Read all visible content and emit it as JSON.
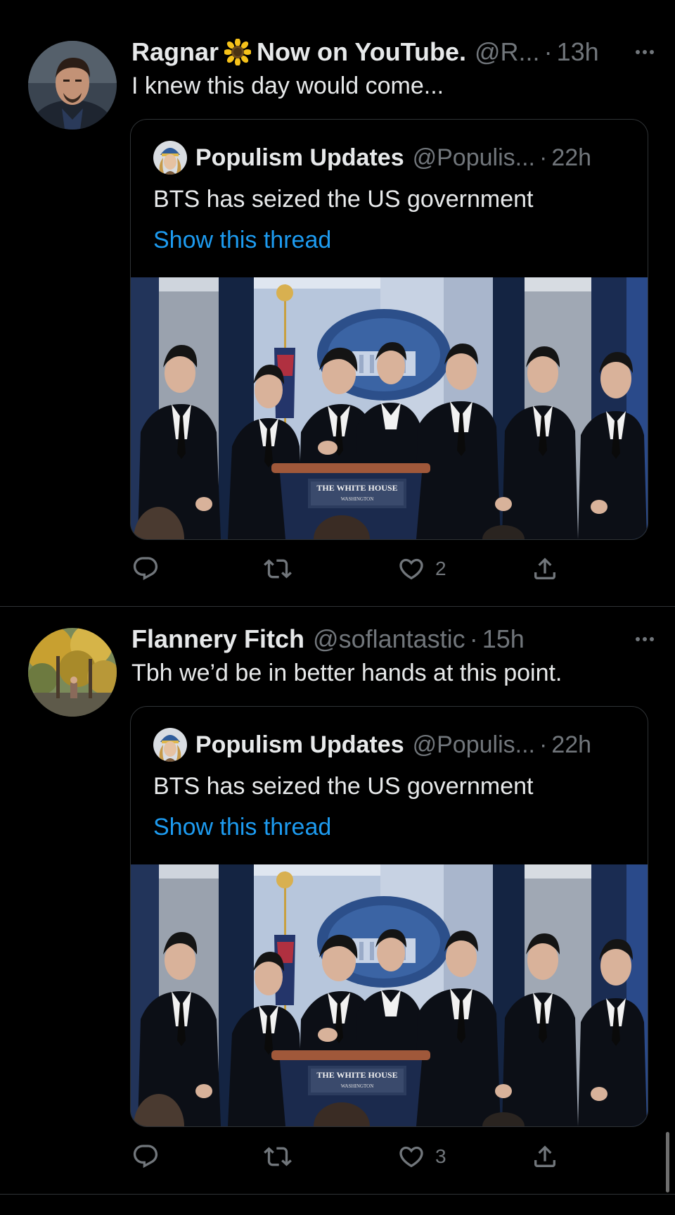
{
  "tweets": [
    {
      "author_name": "Ragnar",
      "author_name_suffix": "Now on YouTube.",
      "handle": "@R...",
      "time": "13h",
      "text": "I knew this day would come...",
      "quote": {
        "author_name": "Populism Updates",
        "handle": "@Populis...",
        "time": "22h",
        "text": "BTS has seized the US government",
        "link": "Show this thread",
        "media_signage": "THE WHITE HOUSE",
        "media_signage_sub": "WASHINGTON"
      },
      "actions": {
        "reply": "",
        "retweet": "",
        "like": "2",
        "share": ""
      }
    },
    {
      "author_name": "Flannery Fitch",
      "handle": "@soflantastic",
      "time": "15h",
      "text": "Tbh we’d be in better hands at this point.",
      "quote": {
        "author_name": "Populism Updates",
        "handle": "@Populis...",
        "time": "22h",
        "text": "BTS has seized the US government",
        "link": "Show this thread",
        "media_signage": "THE WHITE HOUSE",
        "media_signage_sub": "WASHINGTON"
      },
      "actions": {
        "reply": "",
        "retweet": "",
        "like": "3",
        "share": ""
      }
    }
  ],
  "colors": {
    "background": "#000000",
    "text_primary": "#e7e9ea",
    "text_secondary": "#71767b",
    "link": "#1d9bf0",
    "divider": "#2f3336"
  },
  "icons": [
    "sunflower-emoji",
    "more-icon",
    "reply-icon",
    "retweet-icon",
    "like-icon",
    "share-icon"
  ]
}
